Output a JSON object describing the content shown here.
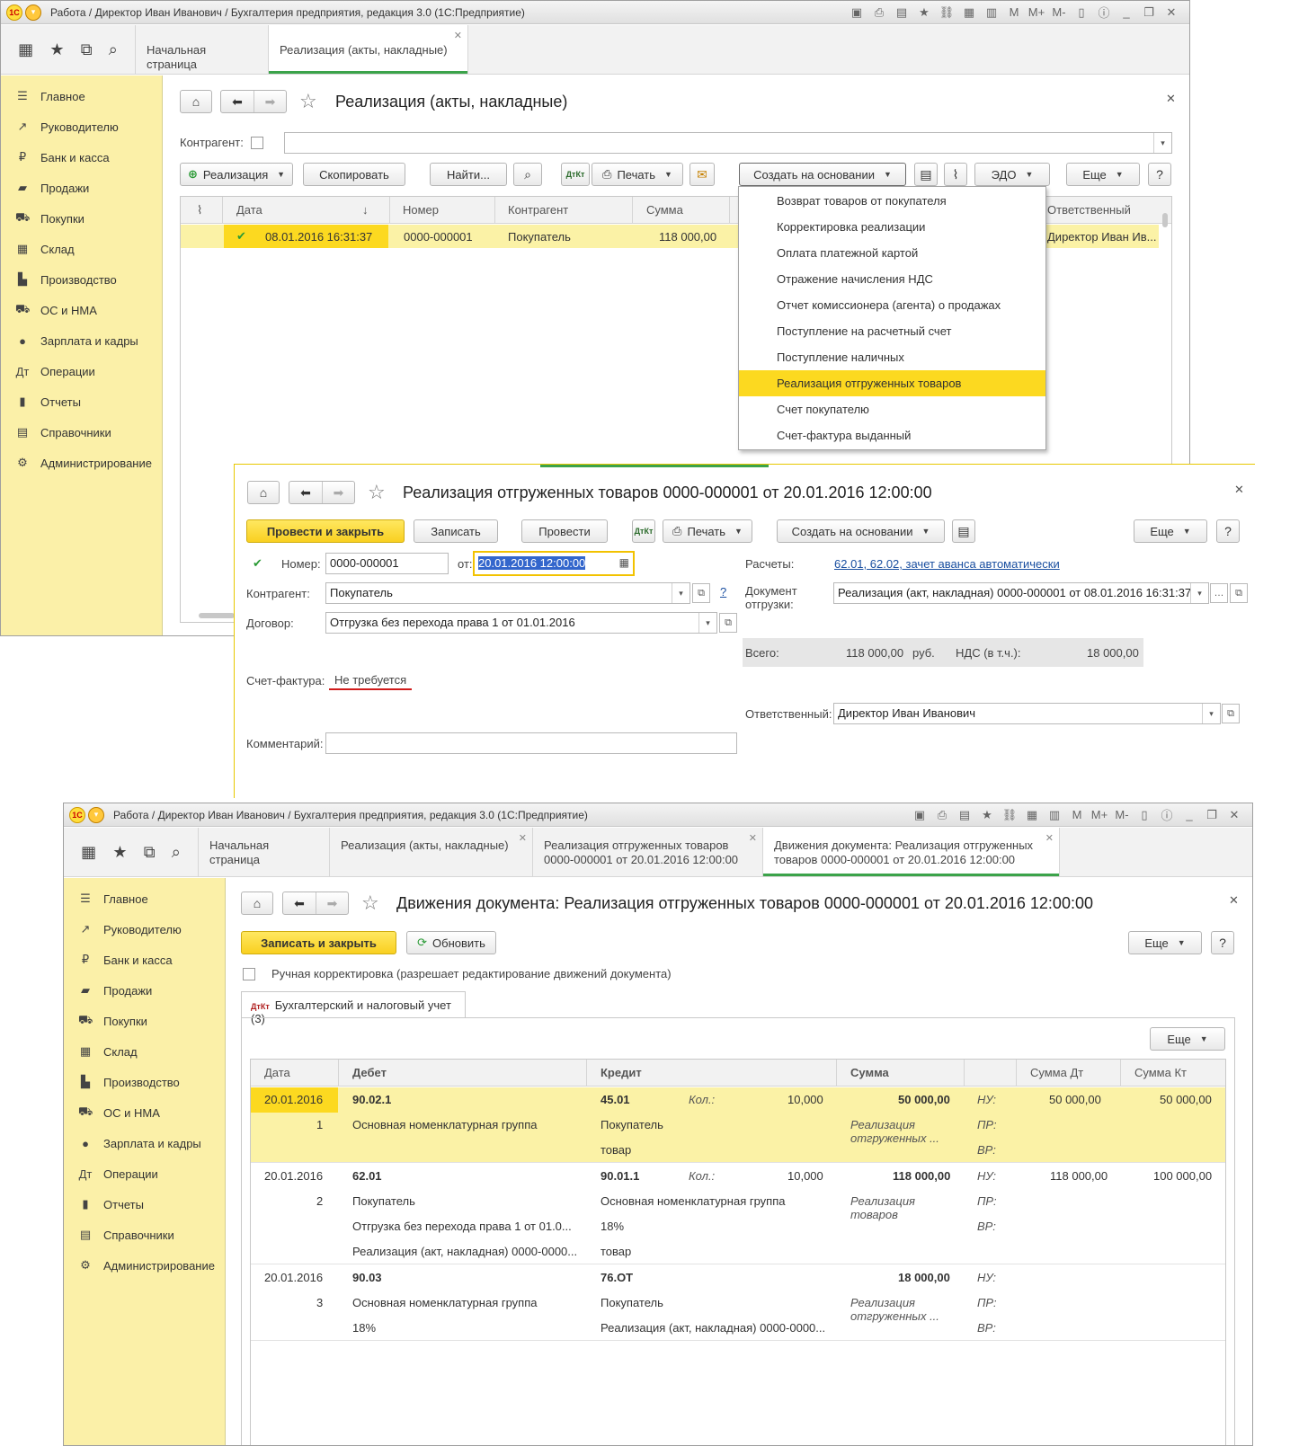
{
  "window1": {
    "title": "Работа / Директор Иван Иванович / Бухгалтерия предприятия, редакция 3.0  (1С:Предприятие)",
    "tabs": [
      "Начальная страница",
      "Реализация (акты, накладные)"
    ],
    "sidebar": [
      {
        "label": "Главное",
        "icon": "menu-icon"
      },
      {
        "label": "Руководителю",
        "icon": "chart-icon"
      },
      {
        "label": "Банк и касса",
        "icon": "ruble-icon"
      },
      {
        "label": "Продажи",
        "icon": "bag-icon"
      },
      {
        "label": "Покупки",
        "icon": "cart-icon"
      },
      {
        "label": "Склад",
        "icon": "warehouse-icon"
      },
      {
        "label": "Производство",
        "icon": "factory-icon"
      },
      {
        "label": "ОС и НМА",
        "icon": "truck-icon"
      },
      {
        "label": "Зарплата и кадры",
        "icon": "person-icon"
      },
      {
        "label": "Операции",
        "icon": "dtkt-icon"
      },
      {
        "label": "Отчеты",
        "icon": "bars-icon"
      },
      {
        "label": "Справочники",
        "icon": "book-icon"
      },
      {
        "label": "Администрирование",
        "icon": "gear-icon"
      }
    ],
    "form_title": "Реализация (акты, накладные)",
    "kontragent_label": "Контрагент:",
    "buttons": {
      "realizaciya": "Реализация",
      "copy": "Скопировать",
      "find": "Найти...",
      "print": "Печать",
      "create_basis": "Создать на основании",
      "edo": "ЭДО",
      "more": "Еще",
      "help": "?"
    },
    "grid_headers": [
      "Дата",
      "Номер",
      "Контрагент",
      "Сумма",
      "Ответственный"
    ],
    "row": {
      "date": "08.01.2016 16:31:37",
      "number": "0000-000001",
      "kontragent": "Покупатель",
      "sum": "118 000,00",
      "responsible": "Директор Иван Ив..."
    },
    "menu_items": [
      "Возврат товаров от покупателя",
      "Корректировка реализации",
      "Оплата платежной картой",
      "Отражение начисления НДС",
      "Отчет комиссионера (агента) о продажах",
      "Поступление на расчетный счет",
      "Поступление наличных",
      "Реализация отгруженных товаров",
      "Счет покупателю",
      "Счет-фактура выданный"
    ]
  },
  "window2": {
    "title": "Реализация отгруженных товаров 0000-000001 от 20.01.2016 12:00:00",
    "buttons": {
      "post_close": "Провести и закрыть",
      "save": "Записать",
      "post": "Провести",
      "print": "Печать",
      "create_basis": "Создать на основании",
      "more": "Еще",
      "help": "?"
    },
    "number_label": "Номер:",
    "number": "0000-000001",
    "from_label": "от:",
    "date": "20.01.2016 12:00:00",
    "kontragent_label": "Контрагент:",
    "kontragent": "Покупатель",
    "dogovor_label": "Договор:",
    "dogovor": "Отгрузка без перехода права 1 от 01.01.2016",
    "invoice_label": "Счет-фактура:",
    "invoice_value": "Не требуется",
    "comment_label": "Комментарий:",
    "raschety_label": "Расчеты:",
    "raschety_link": "62.01, 62.02, зачет аванса автоматически",
    "help_q": "?",
    "doc_label_1": "Документ",
    "doc_label_2": "отгрузки:",
    "doc_value": "Реализация (акт, накладная) 0000-000001 от 08.01.2016 16:31:37",
    "total_label": "Всего:",
    "total": "118 000,00",
    "currency": "руб.",
    "vat_label": "НДС (в т.ч.):",
    "vat": "18 000,00",
    "responsible_label": "Ответственный:",
    "responsible": "Директор Иван Иванович"
  },
  "window3": {
    "title": "Работа / Директор Иван Иванович / Бухгалтерия предприятия, редакция 3.0  (1С:Предприятие)",
    "tabs": [
      {
        "l1": "Начальная страница",
        "l2": ""
      },
      {
        "l1": "Реализация (акты, накладные)",
        "l2": ""
      },
      {
        "l1": "Реализация отгруженных товаров",
        "l2": "0000-000001 от 20.01.2016 12:00:00"
      },
      {
        "l1": "Движения документа: Реализация отгруженных",
        "l2": "товаров 0000-000001 от 20.01.2016 12:00:00"
      }
    ],
    "form_title": "Движения документа: Реализация отгруженных товаров 0000-000001 от 20.01.2016 12:00:00",
    "buttons": {
      "save_close": "Записать и закрыть",
      "refresh": "Обновить",
      "more": "Еще",
      "help": "?"
    },
    "manual_label": "Ручная корректировка (разрешает редактирование движений документа)",
    "subtab": "Бухгалтерский и налоговый учет (3)",
    "grid_headers": [
      "Дата",
      "Дебет",
      "Кредит",
      "Сумма",
      "Сумма Дт",
      "Сумма Кт"
    ],
    "entries": [
      {
        "date": "20.01.2016",
        "n": "1",
        "debit": [
          "90.02.1",
          "Основная номенклатурная группа",
          ""
        ],
        "credit": [
          "45.01",
          "Покупатель",
          "товар"
        ],
        "qty_label": "Кол.:",
        "qty": "10,000",
        "sum": "50 000,00",
        "content": [
          "Реализация",
          "отгруженных ..."
        ],
        "nu": "50 000,00",
        "nu_kt": "50 000,00"
      },
      {
        "date": "20.01.2016",
        "n": "2",
        "debit": [
          "62.01",
          "Покупатель",
          "Отгрузка без перехода права 1 от 01.0...",
          "Реализация (акт, накладная) 0000-0000..."
        ],
        "credit": [
          "90.01.1",
          "Основная номенклатурная группа",
          "18%",
          "товар"
        ],
        "qty_label": "Кол.:",
        "qty": "10,000",
        "sum": "118 000,00",
        "content": [
          "Реализация",
          "товаров"
        ],
        "nu": "118 000,00",
        "nu_kt": "100 000,00"
      },
      {
        "date": "20.01.2016",
        "n": "3",
        "debit": [
          "90.03",
          "Основная номенклатурная группа",
          "18%"
        ],
        "credit": [
          "76.ОТ",
          "Покупатель",
          "Реализация (акт, накладная) 0000-0000..."
        ],
        "sum": "18 000,00",
        "content": [
          "Реализация",
          "отгруженных ..."
        ]
      }
    ],
    "tax_labels": [
      "НУ:",
      "ПР:",
      "ВР:"
    ]
  }
}
